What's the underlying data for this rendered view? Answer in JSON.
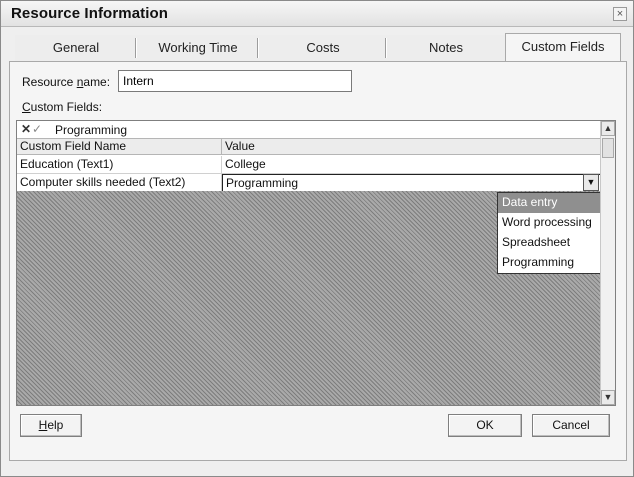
{
  "window": {
    "title": "Resource Information",
    "close_glyph": "×"
  },
  "tabs": [
    {
      "label": "General"
    },
    {
      "label": "Working Time"
    },
    {
      "label": "Costs"
    },
    {
      "label": "Notes"
    },
    {
      "label": "Custom Fields",
      "active": true
    }
  ],
  "resource_name": {
    "label_pre": "Resource ",
    "label_u": "n",
    "label_post": "ame:",
    "value": "Intern"
  },
  "custom_fields": {
    "label_u": "C",
    "label_post": "ustom Fields:"
  },
  "editbar": {
    "cancel_glyph": "✕",
    "enter_glyph": "✓",
    "value": "Programming"
  },
  "table": {
    "headers": [
      "Custom Field Name",
      "Value"
    ],
    "rows": [
      {
        "name": "Education (Text1)",
        "value": "College"
      },
      {
        "name": "Computer skills needed (Text2)",
        "value": "Programming"
      }
    ]
  },
  "dropdown": {
    "options": [
      "Data entry",
      "Word processing",
      "Spreadsheet",
      "Programming"
    ],
    "highlighted": "Data entry"
  },
  "buttons": {
    "help_u": "H",
    "help_post": "elp",
    "ok": "OK",
    "cancel": "Cancel"
  },
  "icons": [
    "close-icon",
    "scroll-up-arrow-icon",
    "scroll-down-arrow-icon",
    "dropdown-arrow-icon"
  ]
}
